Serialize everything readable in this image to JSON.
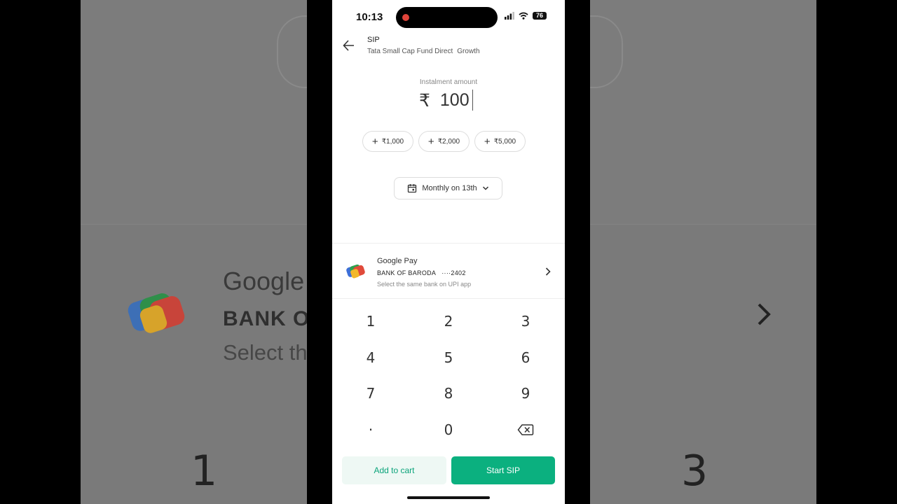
{
  "status_bar": {
    "time": "10:13",
    "battery": "76"
  },
  "header": {
    "title": "SIP",
    "fund_name": "Tata Small Cap Fund Direct",
    "plan": "Growth"
  },
  "amount": {
    "label": "Instalment amount",
    "currency": "₹",
    "value": "100"
  },
  "quick_add": [
    {
      "sign": "+",
      "label": "₹1,000"
    },
    {
      "sign": "+",
      "label": "₹2,000"
    },
    {
      "sign": "+",
      "label": "₹5,000"
    }
  ],
  "frequency": {
    "label": "Monthly on 13th"
  },
  "payment": {
    "name": "Google Pay",
    "bank": "BANK OF BARODA",
    "account": "····2402",
    "note": "Select the same bank on UPI app"
  },
  "keypad": [
    "1",
    "2",
    "3",
    "4",
    "5",
    "6",
    "7",
    "8",
    "9",
    "·",
    "0"
  ],
  "actions": {
    "add_to_cart": "Add to cart",
    "start": "Start SIP"
  },
  "background": {
    "title_fragment": "Google",
    "bank_fragment": "BANK OF",
    "note_fragment": "Select th",
    "key_left": "1",
    "key_right": "3"
  },
  "colors": {
    "accent": "#0bb07f",
    "accent_light": "#eef8f4",
    "record": "#e0443a"
  }
}
